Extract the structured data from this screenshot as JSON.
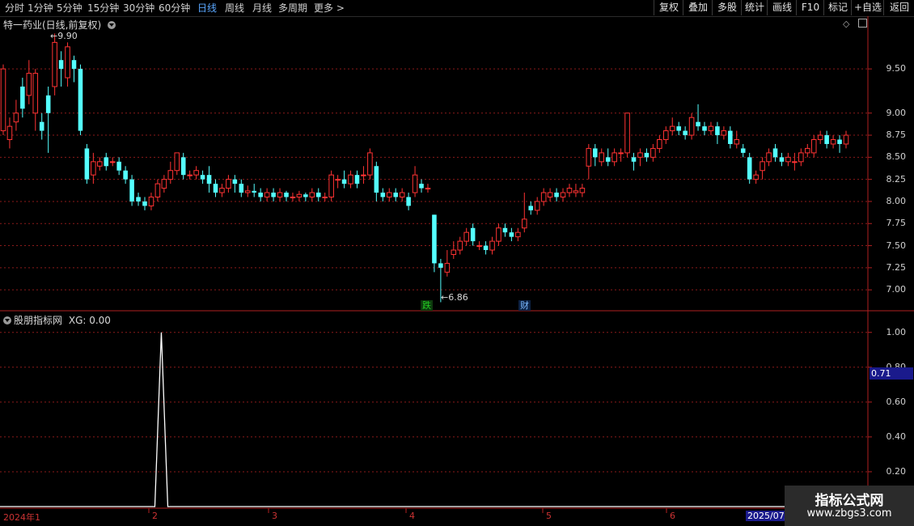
{
  "toolbar": {
    "periods": [
      "分时",
      "1分钟",
      "5分钟",
      "15分钟",
      "30分钟",
      "60分钟",
      "日线",
      "周线",
      "月线",
      "多周期",
      "更多"
    ],
    "active_period": "日线",
    "right_buttons": [
      "复权",
      "叠加",
      "多股",
      "统计",
      "画线",
      "F10",
      "标记",
      "+自选",
      "返回"
    ]
  },
  "main_panel": {
    "title": "特一药业(日线,前复权)",
    "high_marker": "9.90",
    "low_marker": "6.86",
    "event_tags": [
      {
        "text": "跌",
        "color": "#22cc22"
      },
      {
        "text": "财",
        "color": "#5aa7ff"
      }
    ]
  },
  "indicator_panel": {
    "title": "股朋指标网",
    "value_label": "XG: 0.00",
    "current_value": "0.71"
  },
  "date_axis": [
    "2024年1",
    "2",
    "3",
    "4",
    "5",
    "6",
    "2025/07/"
  ],
  "watermark": {
    "line1": "指标公式网",
    "line2": "www.zbgs3.com"
  },
  "colors": {
    "up": "#ff3333",
    "down": "#54ffff",
    "grid": "#8b1a1a",
    "border": "#b02020",
    "indicator": "#ffffff"
  },
  "chart_data": [
    {
      "type": "candlestick",
      "title": "特一药业(日线,前复权)",
      "y_ticks": [
        "9.50",
        "9.00",
        "8.75",
        "8.50",
        "8.25",
        "8.00",
        "7.75",
        "7.50",
        "7.25",
        "7.00"
      ],
      "ylim": [
        6.8,
        9.95
      ],
      "candles": [
        [
          8.8,
          9.5,
          9.55,
          8.75
        ],
        [
          8.7,
          8.85,
          8.95,
          8.6
        ],
        [
          8.9,
          9.0,
          9.15,
          8.8
        ],
        [
          9.3,
          9.05,
          9.4,
          8.95
        ],
        [
          9.2,
          9.45,
          9.6,
          9.1
        ],
        [
          9.0,
          9.45,
          9.5,
          8.8
        ],
        [
          8.9,
          8.8,
          9.0,
          8.7
        ],
        [
          9.2,
          9.0,
          9.3,
          8.55
        ],
        [
          9.3,
          9.8,
          9.9,
          9.2
        ],
        [
          9.6,
          9.5,
          9.7,
          9.3
        ],
        [
          9.4,
          9.75,
          9.8,
          9.3
        ],
        [
          9.6,
          9.5,
          9.65,
          9.35
        ],
        [
          9.5,
          8.8,
          9.55,
          8.75
        ],
        [
          8.6,
          8.25,
          8.65,
          8.2
        ],
        [
          8.3,
          8.45,
          8.55,
          8.2
        ],
        [
          8.4,
          8.45,
          8.5,
          8.35
        ],
        [
          8.5,
          8.4,
          8.55,
          8.35
        ],
        [
          8.45,
          8.45,
          8.5,
          8.4
        ],
        [
          8.45,
          8.35,
          8.5,
          8.3
        ],
        [
          8.35,
          8.25,
          8.4,
          8.2
        ],
        [
          8.25,
          8.0,
          8.3,
          7.95
        ],
        [
          8.05,
          8.0,
          8.1,
          7.95
        ],
        [
          8.0,
          7.95,
          8.05,
          7.9
        ],
        [
          7.95,
          8.05,
          8.1,
          7.9
        ],
        [
          8.05,
          8.2,
          8.25,
          8.0
        ],
        [
          8.15,
          8.25,
          8.3,
          8.1
        ],
        [
          8.25,
          8.35,
          8.45,
          8.2
        ],
        [
          8.35,
          8.55,
          8.55,
          8.3
        ],
        [
          8.5,
          8.3,
          8.55,
          8.25
        ],
        [
          8.3,
          8.3,
          8.35,
          8.25
        ],
        [
          8.3,
          8.35,
          8.4,
          8.25
        ],
        [
          8.3,
          8.25,
          8.35,
          8.2
        ],
        [
          8.3,
          8.2,
          8.4,
          8.1
        ],
        [
          8.2,
          8.1,
          8.25,
          8.05
        ],
        [
          8.1,
          8.15,
          8.2,
          8.05
        ],
        [
          8.15,
          8.25,
          8.3,
          8.1
        ],
        [
          8.25,
          8.2,
          8.3,
          8.1
        ],
        [
          8.2,
          8.1,
          8.25,
          8.05
        ],
        [
          8.1,
          8.12,
          8.18,
          8.05
        ],
        [
          8.12,
          8.1,
          8.2,
          8.05
        ],
        [
          8.1,
          8.05,
          8.15,
          8.0
        ],
        [
          8.05,
          8.1,
          8.15,
          8.0
        ],
        [
          8.1,
          8.05,
          8.15,
          8.0
        ],
        [
          8.05,
          8.1,
          8.15,
          8.0
        ],
        [
          8.1,
          8.05,
          8.12,
          8.0
        ],
        [
          8.05,
          8.05,
          8.1,
          8.0
        ],
        [
          8.05,
          8.08,
          8.12,
          8.0
        ],
        [
          8.08,
          8.05,
          8.1,
          8.0
        ],
        [
          8.05,
          8.1,
          8.15,
          8.0
        ],
        [
          8.1,
          8.05,
          8.15,
          8.0
        ],
        [
          8.05,
          8.05,
          8.1,
          8.0
        ],
        [
          8.05,
          8.3,
          8.35,
          8.0
        ],
        [
          8.25,
          8.25,
          8.3,
          8.15
        ],
        [
          8.25,
          8.2,
          8.35,
          8.15
        ],
        [
          8.2,
          8.3,
          8.35,
          8.15
        ],
        [
          8.3,
          8.2,
          8.35,
          8.15
        ],
        [
          8.3,
          8.3,
          8.4,
          8.2
        ],
        [
          8.3,
          8.55,
          8.6,
          8.25
        ],
        [
          8.4,
          8.1,
          8.45,
          8.0
        ],
        [
          8.1,
          8.05,
          8.15,
          8.0
        ],
        [
          8.05,
          8.1,
          8.15,
          8.0
        ],
        [
          8.1,
          8.05,
          8.15,
          8.0
        ],
        [
          8.05,
          8.1,
          8.15,
          8.0
        ],
        [
          8.05,
          7.95,
          8.1,
          7.9
        ],
        [
          8.1,
          8.3,
          8.4,
          8.05
        ],
        [
          8.2,
          8.15,
          8.25,
          8.1
        ],
        [
          8.15,
          8.15,
          8.2,
          8.1
        ],
        [
          7.85,
          7.3,
          7.85,
          7.2
        ],
        [
          7.3,
          7.25,
          7.35,
          6.86
        ],
        [
          7.2,
          7.3,
          7.45,
          7.15
        ],
        [
          7.4,
          7.45,
          7.55,
          7.35
        ],
        [
          7.45,
          7.55,
          7.6,
          7.4
        ],
        [
          7.55,
          7.65,
          7.7,
          7.5
        ],
        [
          7.7,
          7.55,
          7.75,
          7.5
        ],
        [
          7.5,
          7.5,
          7.55,
          7.45
        ],
        [
          7.5,
          7.45,
          7.55,
          7.4
        ],
        [
          7.45,
          7.55,
          7.6,
          7.4
        ],
        [
          7.55,
          7.7,
          7.75,
          7.5
        ],
        [
          7.7,
          7.65,
          7.75,
          7.6
        ],
        [
          7.65,
          7.6,
          7.7,
          7.55
        ],
        [
          7.6,
          7.65,
          7.7,
          7.55
        ],
        [
          7.7,
          7.8,
          8.1,
          7.65
        ],
        [
          7.95,
          7.9,
          8.0,
          7.85
        ],
        [
          7.9,
          8.0,
          8.05,
          7.85
        ],
        [
          8.0,
          8.1,
          8.15,
          7.95
        ],
        [
          8.05,
          8.1,
          8.15,
          8.0
        ],
        [
          8.1,
          8.05,
          8.15,
          8.0
        ],
        [
          8.05,
          8.1,
          8.15,
          8.0
        ],
        [
          8.1,
          8.15,
          8.2,
          8.05
        ],
        [
          8.1,
          8.12,
          8.2,
          8.05
        ],
        [
          8.1,
          8.15,
          8.2,
          8.05
        ],
        [
          8.4,
          8.6,
          8.65,
          8.25
        ],
        [
          8.6,
          8.5,
          8.65,
          8.4
        ],
        [
          8.45,
          8.55,
          8.6,
          8.4
        ],
        [
          8.5,
          8.45,
          8.6,
          8.4
        ],
        [
          8.45,
          8.55,
          8.6,
          8.4
        ],
        [
          8.55,
          8.55,
          8.6,
          8.45
        ],
        [
          8.55,
          9.0,
          9.0,
          8.5
        ],
        [
          8.5,
          8.45,
          8.55,
          8.35
        ],
        [
          8.5,
          8.55,
          8.6,
          8.4
        ],
        [
          8.55,
          8.5,
          8.6,
          8.45
        ],
        [
          8.5,
          8.6,
          8.65,
          8.45
        ],
        [
          8.6,
          8.7,
          8.75,
          8.55
        ],
        [
          8.7,
          8.8,
          8.85,
          8.65
        ],
        [
          8.8,
          8.85,
          8.95,
          8.75
        ],
        [
          8.85,
          8.8,
          8.9,
          8.75
        ],
        [
          8.8,
          8.75,
          8.85,
          8.7
        ],
        [
          8.75,
          8.95,
          9.0,
          8.7
        ],
        [
          8.9,
          8.85,
          9.1,
          8.8
        ],
        [
          8.85,
          8.8,
          8.9,
          8.75
        ],
        [
          8.8,
          8.85,
          8.9,
          8.75
        ],
        [
          8.85,
          8.75,
          8.9,
          8.65
        ],
        [
          8.75,
          8.8,
          8.85,
          8.7
        ],
        [
          8.8,
          8.65,
          8.85,
          8.6
        ],
        [
          8.65,
          8.7,
          8.8,
          8.6
        ],
        [
          8.6,
          8.55,
          8.65,
          8.5
        ],
        [
          8.5,
          8.25,
          8.55,
          8.2
        ],
        [
          8.25,
          8.3,
          8.35,
          8.2
        ],
        [
          8.35,
          8.45,
          8.5,
          8.25
        ],
        [
          8.45,
          8.55,
          8.6,
          8.4
        ],
        [
          8.6,
          8.5,
          8.65,
          8.45
        ],
        [
          8.5,
          8.45,
          8.55,
          8.4
        ],
        [
          8.45,
          8.5,
          8.55,
          8.4
        ],
        [
          8.45,
          8.45,
          8.55,
          8.35
        ],
        [
          8.45,
          8.55,
          8.6,
          8.4
        ],
        [
          8.55,
          8.6,
          8.65,
          8.5
        ],
        [
          8.55,
          8.7,
          8.75,
          8.5
        ],
        [
          8.7,
          8.75,
          8.8,
          8.65
        ],
        [
          8.75,
          8.65,
          8.8,
          8.6
        ],
        [
          8.65,
          8.7,
          8.75,
          8.6
        ],
        [
          8.7,
          8.65,
          8.75,
          8.55
        ],
        [
          8.65,
          8.75,
          8.8,
          8.6
        ]
      ]
    },
    {
      "type": "line",
      "title": "股朋指标网",
      "y_ticks": [
        "1.00",
        "0.80",
        "0.60",
        "0.40",
        "0.20"
      ],
      "ylim": [
        0,
        1.05
      ],
      "spike_index": 12,
      "values_note": "XG is 0 everywhere except a single spike to 1.00"
    }
  ]
}
